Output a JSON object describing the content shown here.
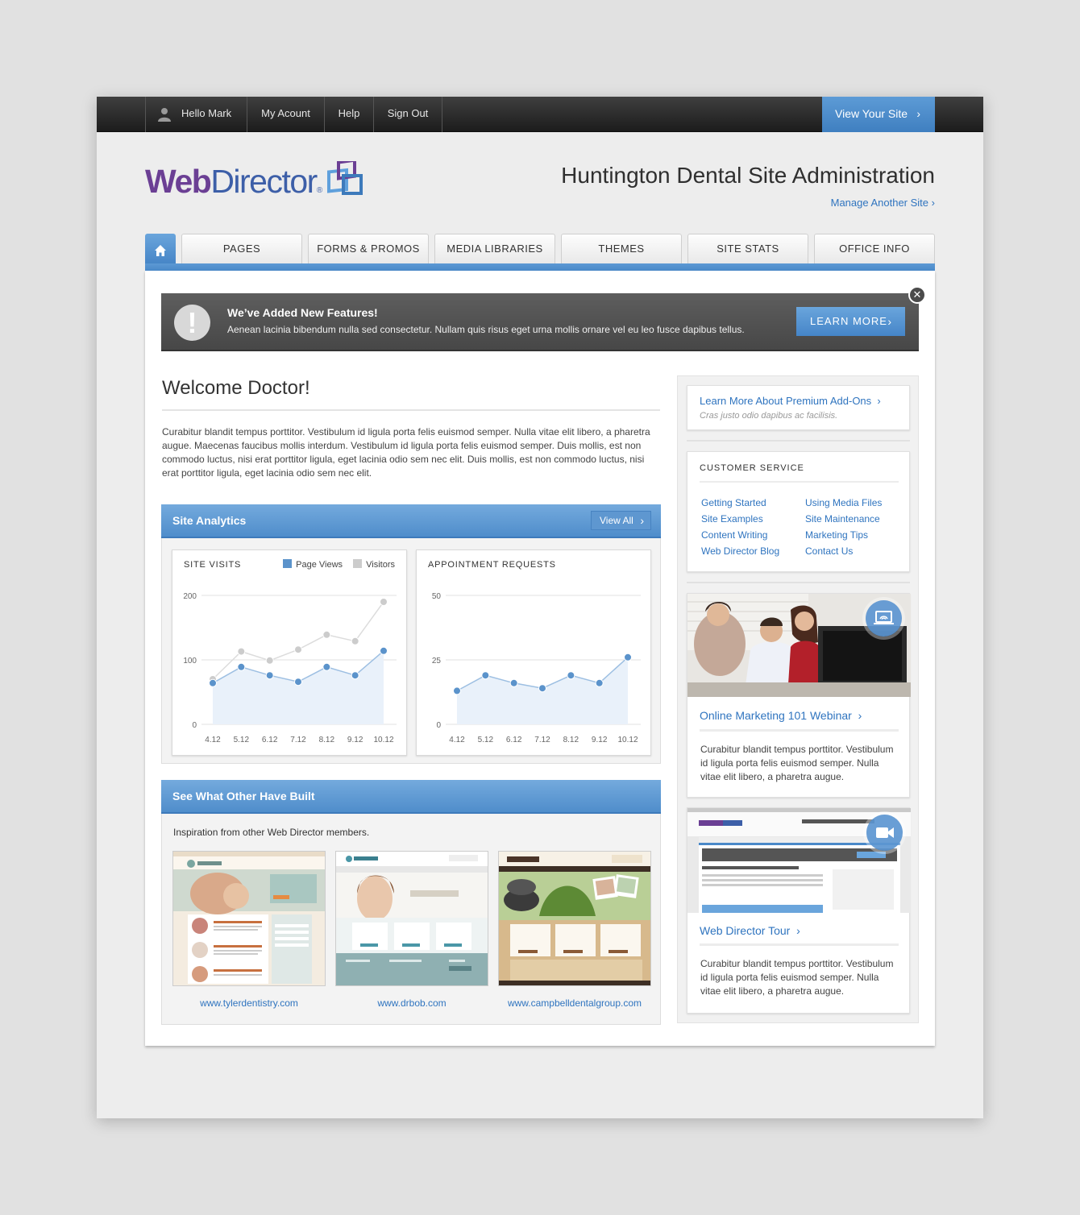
{
  "topbar": {
    "user_greeting": "Hello Mark",
    "account": "My Acount",
    "help": "Help",
    "sign_out": "Sign Out",
    "view_site": "View Your Site"
  },
  "header": {
    "logo_web": "Web",
    "logo_director": "Director",
    "logo_mark": "®",
    "site_title": "Huntington Dental Site Administration",
    "manage_link": "Manage Another Site"
  },
  "nav": {
    "tabs": [
      "PAGES",
      "FORMS & PROMOS",
      "MEDIA LIBRARIES",
      "THEMES",
      "SITE STATS",
      "OFFICE INFO"
    ]
  },
  "alert": {
    "icon": "!",
    "title": "We’ve Added New Features!",
    "body": "Aenean lacinia bibendum nulla sed consectetur. Nullam quis risus eget urna mollis ornare vel eu leo fusce dapibus tellus.",
    "button": "LEARN MORE"
  },
  "welcome": {
    "title": "Welcome Doctor!",
    "body": "Curabitur blandit tempus porttitor. Vestibulum id ligula porta felis euismod semper. Nulla vitae elit libero, a pharetra augue. Maecenas faucibus mollis interdum. Vestibulum id ligula porta felis euismod semper. Duis mollis, est non commodo luctus, nisi erat porttitor ligula, eget lacinia odio sem nec elit. Duis mollis, est non commodo luctus, nisi erat porttitor ligula, eget lacinia odio sem nec elit."
  },
  "analytics": {
    "title": "Site Analytics",
    "view_all": "View All"
  },
  "chart_data": [
    {
      "type": "line",
      "title": "SITE VISITS",
      "x": [
        "4.12",
        "5.12",
        "6.12",
        "7.12",
        "8.12",
        "9.12",
        "10.12"
      ],
      "yticks": [
        "200",
        "100",
        "0"
      ],
      "ylim": [
        0,
        200
      ],
      "series": [
        {
          "name": "Page Views",
          "color": "#5b93cb",
          "values": [
            64,
            89,
            76,
            66,
            89,
            76,
            114
          ]
        },
        {
          "name": "Visitors",
          "color": "#cccccc",
          "values": [
            70,
            113,
            99,
            116,
            139,
            129,
            190
          ]
        }
      ],
      "grid": true,
      "legend": "top-right"
    },
    {
      "type": "line",
      "title": "APPOINTMENT REQUESTS",
      "x": [
        "4.12",
        "5.12",
        "6.12",
        "7.12",
        "8.12",
        "9.12",
        "10.12"
      ],
      "yticks": [
        "50",
        "25",
        "0"
      ],
      "ylim": [
        0,
        50
      ],
      "series": [
        {
          "color": "#5b93cb",
          "values": [
            13,
            19,
            16,
            14,
            19,
            16,
            26
          ]
        }
      ],
      "grid": true
    }
  ],
  "built": {
    "title": "See What Other Have Built",
    "intro": "Inspiration from other Web Director members.",
    "sites": [
      "www.tylerdentistry.com",
      "www.drbob.com",
      "www.campbelldentalgroup.com"
    ]
  },
  "sidebar": {
    "premium": {
      "link": "Learn More About Premium Add-Ons",
      "sub": "Cras justo odio dapibus ac facilisis."
    },
    "customer_service": {
      "title": "CUSTOMER SERVICE",
      "links": [
        "Getting Started",
        "Site Examples",
        "Content Writing",
        "Web Director Blog",
        "Using Media Files",
        "Site Maintenance",
        "Marketing Tips",
        "Contact Us"
      ]
    },
    "webinar": {
      "link": "Online Marketing 101 Webinar",
      "body": "Curabitur blandit tempus porttitor. Vestibulum id ligula porta felis euismod semper. Nulla vitae elit libero, a pharetra augue."
    },
    "tour": {
      "link": "Web Director Tour",
      "body": "Curabitur blandit tempus porttitor. Vestibulum id ligula porta felis euismod semper. Nulla vitae elit libero, a pharetra augue."
    }
  },
  "colors": {
    "accent": "#4a89c9",
    "link": "#2f74bf",
    "topbar": "#2a2a2a"
  }
}
